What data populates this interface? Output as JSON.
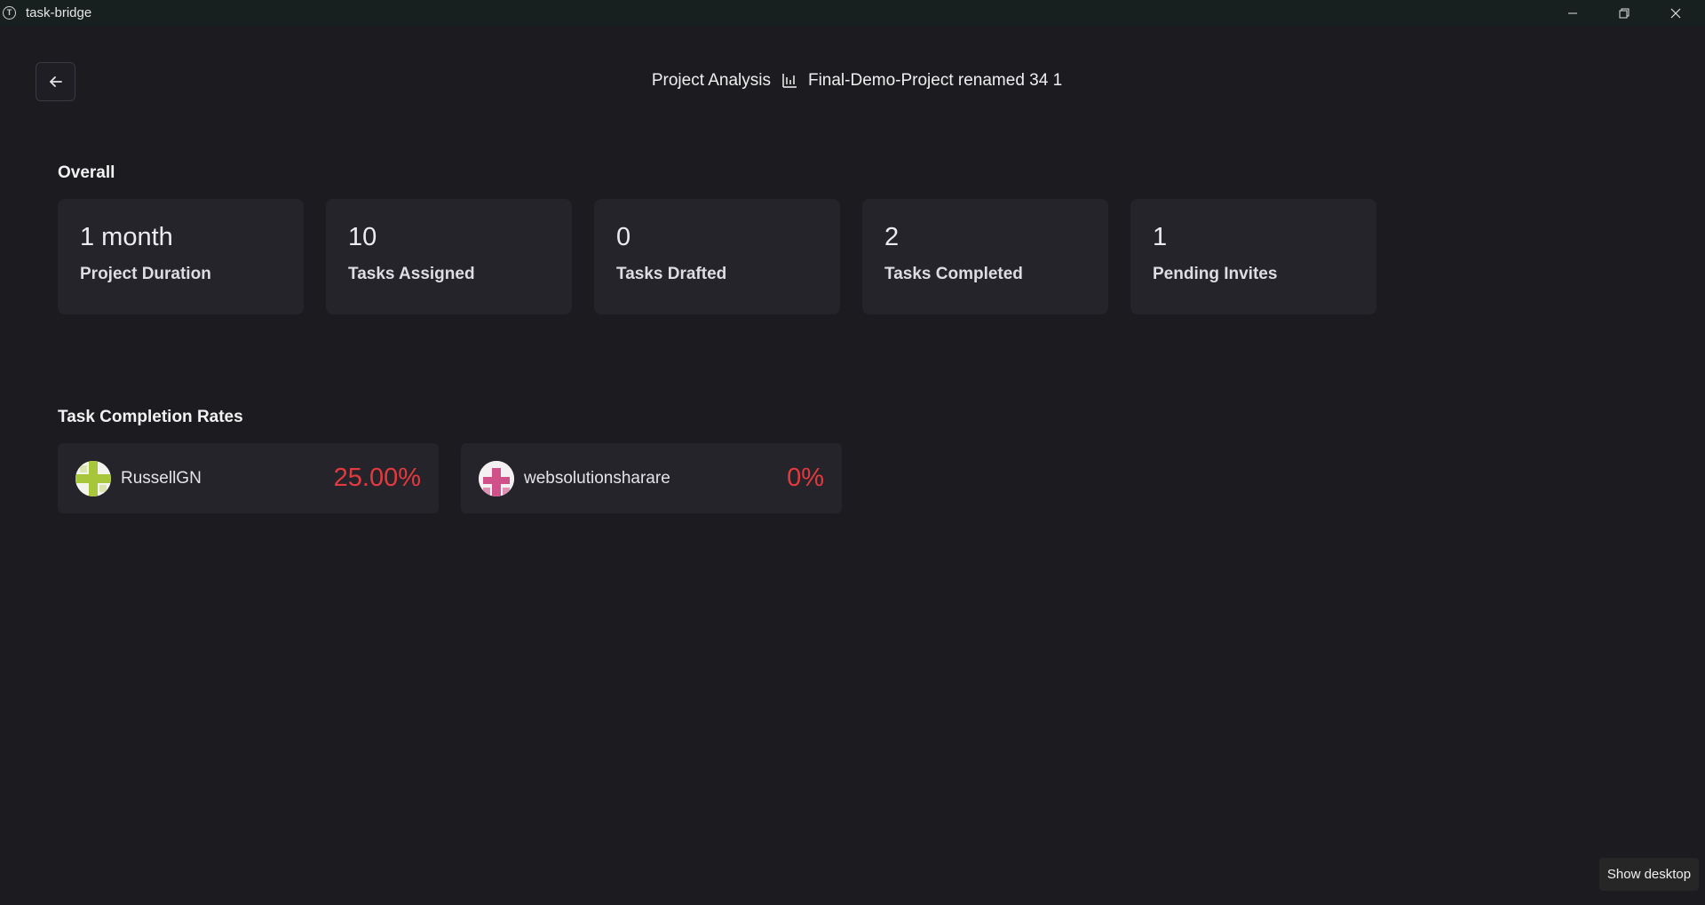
{
  "window": {
    "title": "task-bridge",
    "controls": [
      "minimize-icon",
      "restore-icon",
      "close-icon"
    ]
  },
  "header": {
    "page_label": "Project Analysis",
    "icon": "bar-chart-icon",
    "project_name": "Final-Demo-Project renamed 34 1",
    "back_icon": "arrow-left-icon"
  },
  "overall": {
    "title": "Overall",
    "stats": [
      {
        "value": "1 month",
        "label": "Project Duration"
      },
      {
        "value": "10",
        "label": "Tasks Assigned"
      },
      {
        "value": "0",
        "label": "Tasks Drafted"
      },
      {
        "value": "2",
        "label": "Tasks Completed"
      },
      {
        "value": "1",
        "label": "Pending Invites"
      }
    ]
  },
  "completion_rates": {
    "title": "Task Completion Rates",
    "members": [
      {
        "name": "RussellGN",
        "rate": "25.00%",
        "avatar_color": "#a8c63a"
      },
      {
        "name": "websolutionsharare",
        "rate": "0%",
        "avatar_color": "#d0508a"
      }
    ],
    "rate_color": "#e23a3f"
  },
  "taskbar": {
    "show_desktop": "Show desktop"
  }
}
